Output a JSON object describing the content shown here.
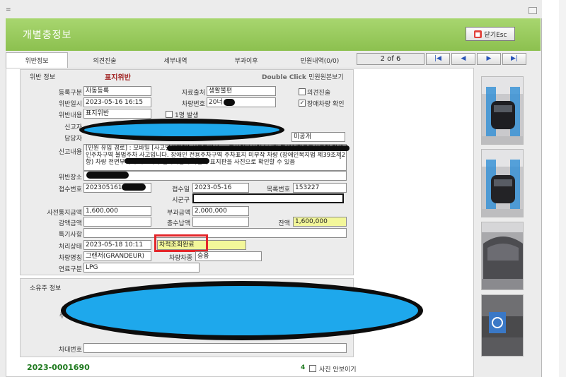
{
  "window": {
    "sysmenu": "="
  },
  "header": {
    "title": "개별충정보",
    "close_label": "닫기Esc",
    "close_icon": "stop-icon"
  },
  "tabs": [
    {
      "label": "위반정보",
      "active": true
    },
    {
      "label": "의견진술"
    },
    {
      "label": "세부내역"
    },
    {
      "label": "부과이후"
    },
    {
      "label": "민원내역(0/0)"
    }
  ],
  "pager": {
    "count": "2 of 6",
    "first": "|◀",
    "prev": "◀",
    "next": "▶",
    "last": "▶|"
  },
  "violation": {
    "section_title": "위반 정보",
    "type_title": "표지위반",
    "double_click": "Double Click",
    "view_original": "민원원본보기",
    "labels": {
      "reg_type": "등록구분",
      "source": "자료출처",
      "violation_date": "위반일시",
      "vehicle_no": "차량번호",
      "violation_content": "위반내용",
      "reporter": "신고자",
      "manager": "담당자",
      "report_content": "신고내용",
      "violation_place": "위반장소",
      "receipt_no": "접수번호",
      "receipt_date": "접수일",
      "list_no": "목록번호",
      "city": "시군구",
      "notice_amount": "사전통지금액",
      "levy_amount": "부과금액",
      "reduction_amount": "감액금액",
      "collected_amount": "충수납액",
      "balance": "잔액",
      "remarks": "특기사항",
      "processing_status": "처리상태",
      "car_name": "차량명칭",
      "vehicle_type": "차량차종",
      "fuel_type": "연료구분"
    },
    "values": {
      "reg_type": "자동등록",
      "source": "생활불편",
      "violation_date": "2023-05-16 16:15",
      "vehicle_no": "20너",
      "violation_content": "표지위반",
      "manager_status": "미공개",
      "report_content": "[민원 유입 경로] : 모바일 [사고발생지역] 서울특별시 ... 주차위반하였습니다 장애인전용주차구역 장애인주차구역 불법주차 사고입니다. 장애인 전용주차구역 주차표지 미부착 차량 (장애인복지법 제39조제2항) 차량 전면부터 주차표지가 연속적인 주차금지 표지판을 사진으로 확인할 수 있음",
      "receipt_no": "20230516162",
      "receipt_date": "2023-05-16",
      "list_no": "153227",
      "notice_amount": "1,600,000",
      "levy_amount": "2,000,000",
      "balance": "1,600,000",
      "processing_status_time": "2023-05-18 10:11",
      "processing_status": "차적조회완료",
      "car_name": "그랜저(GRANDEUR)",
      "vehicle_type": "승용",
      "fuel_type": "LPG"
    },
    "checks": {
      "opinion": {
        "label": "의견진술",
        "checked": false
      },
      "disabled_vehicle": {
        "label": "장애차량 확인",
        "checked": true
      },
      "one_person": {
        "label": "1명 발생",
        "checked": false
      }
    }
  },
  "owner": {
    "section_title": "소유주 정보",
    "labels": {
      "address": "주",
      "car_no_label": "차대번호"
    }
  },
  "photos": [
    {
      "name": "parking-photo-1"
    },
    {
      "name": "parking-photo-2"
    },
    {
      "name": "parking-photo-3"
    },
    {
      "name": "parking-photo-4"
    }
  ],
  "footer": {
    "code": "2023-0001690",
    "photo_count": "4",
    "hide_photos_label": "사진 안보이기"
  },
  "colors": {
    "header_green": "#8cc04f",
    "highlight_yellow": "#f3f79a",
    "redaction_blue": "#1ea8ec",
    "annotation_red": "#e3262a"
  }
}
